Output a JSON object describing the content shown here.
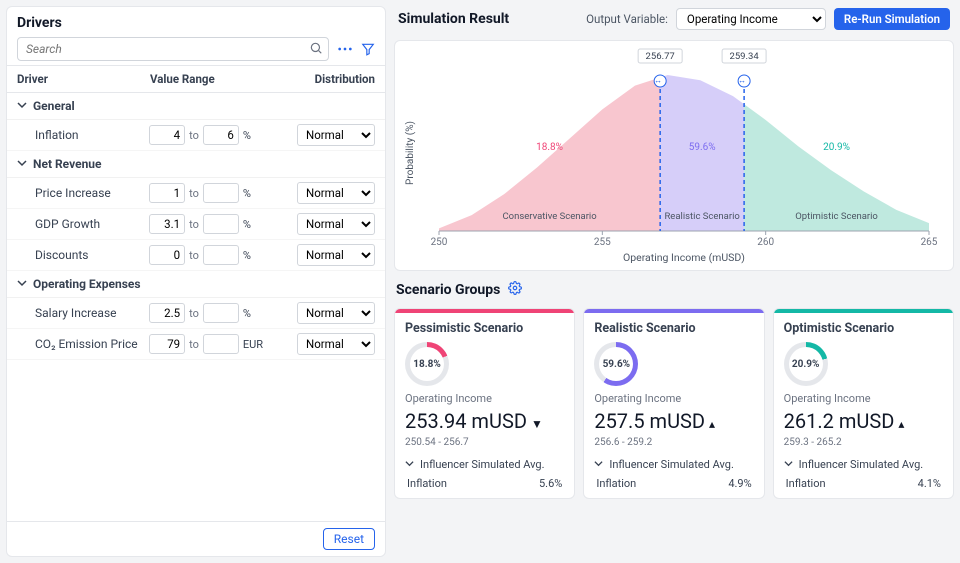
{
  "drivers_panel": {
    "title": "Drivers",
    "search_placeholder": "Search",
    "columns": {
      "driver": "Driver",
      "range": "Value Range",
      "dist": "Distribution"
    },
    "reset_label": "Reset",
    "groups": [
      {
        "name": "General",
        "rows": [
          {
            "name": "Inflation",
            "from": "4",
            "to": "6",
            "unit": "%",
            "dist": "Normal"
          }
        ]
      },
      {
        "name": "Net Revenue",
        "rows": [
          {
            "name": "Price Increase",
            "from": "1",
            "to": "",
            "unit": "%",
            "dist": "Normal"
          },
          {
            "name": "GDP Growth",
            "from": "3.1",
            "to": "",
            "unit": "%",
            "dist": "Normal"
          },
          {
            "name": "Discounts",
            "from": "0",
            "to": "",
            "unit": "%",
            "dist": "Normal"
          }
        ]
      },
      {
        "name": "Operating Expenses",
        "rows": [
          {
            "name": "Salary Increase",
            "from": "2.5",
            "to": "",
            "unit": "%",
            "dist": "Normal"
          },
          {
            "name": "CO₂ Emission Price",
            "from": "79",
            "to": "",
            "unit": "EUR",
            "dist": "Normal"
          }
        ]
      }
    ]
  },
  "simulation": {
    "title": "Simulation Result",
    "output_var_label": "Output Variable:",
    "output_var_value": "Operating Income",
    "rerun_label": "Re-Run Simulation"
  },
  "scenario_groups": {
    "title": "Scenario Groups",
    "cards": [
      {
        "name": "Pessimistic Scenario",
        "color": "#ef4476",
        "pct": "18.8%",
        "metric_label": "Operating Income",
        "value": "253.94 mUSD",
        "arrow": "▼",
        "range": "250.54 - 256.7",
        "influencer_label": "Influencer Simulated Avg.",
        "infl_name": "Inflation",
        "infl_val": "5.6%"
      },
      {
        "name": "Realistic Scenario",
        "color": "#7c6cf0",
        "pct": "59.6%",
        "metric_label": "Operating Income",
        "value": "257.5 mUSD",
        "arrow": "▴",
        "range": "256.6 - 259.2",
        "influencer_label": "Influencer Simulated Avg.",
        "infl_name": "Inflation",
        "infl_val": "4.9%"
      },
      {
        "name": "Optimistic Scenario",
        "color": "#14b8a6",
        "pct": "20.9%",
        "metric_label": "Operating Income",
        "value": "261.2 mUSD",
        "arrow": "▴",
        "range": "259.3 - 265.2",
        "influencer_label": "Influencer Simulated Avg.",
        "infl_name": "Inflation",
        "infl_val": "4.1%"
      }
    ]
  },
  "chart_data": {
    "type": "area",
    "xlabel": "Operating Income (mUSD)",
    "ylabel": "Probability (%)",
    "x_ticks": [
      250,
      255,
      260,
      265
    ],
    "markers": [
      {
        "x": 256.77,
        "label": "256.77"
      },
      {
        "x": 259.34,
        "label": "259.34"
      }
    ],
    "regions": [
      {
        "name": "Conservative Scenario",
        "pct": "18.8%",
        "color": "#f8c6cf",
        "text_color": "#ef4476"
      },
      {
        "name": "Realistic Scenario",
        "pct": "59.6%",
        "color": "#d6cef9",
        "text_color": "#7c6cf0"
      },
      {
        "name": "Optimistic Scenario",
        "pct": "20.9%",
        "color": "#bfe9df",
        "text_color": "#14b8a6"
      }
    ],
    "density_curve": {
      "x": [
        250,
        251,
        252,
        253,
        254,
        255,
        256,
        257,
        258,
        259,
        260,
        261,
        262,
        263,
        264,
        265
      ],
      "y": [
        0.1,
        0.6,
        1.4,
        2.4,
        3.5,
        4.6,
        5.5,
        5.9,
        5.7,
        5.1,
        4.2,
        3.2,
        2.3,
        1.5,
        0.8,
        0.3
      ]
    }
  }
}
